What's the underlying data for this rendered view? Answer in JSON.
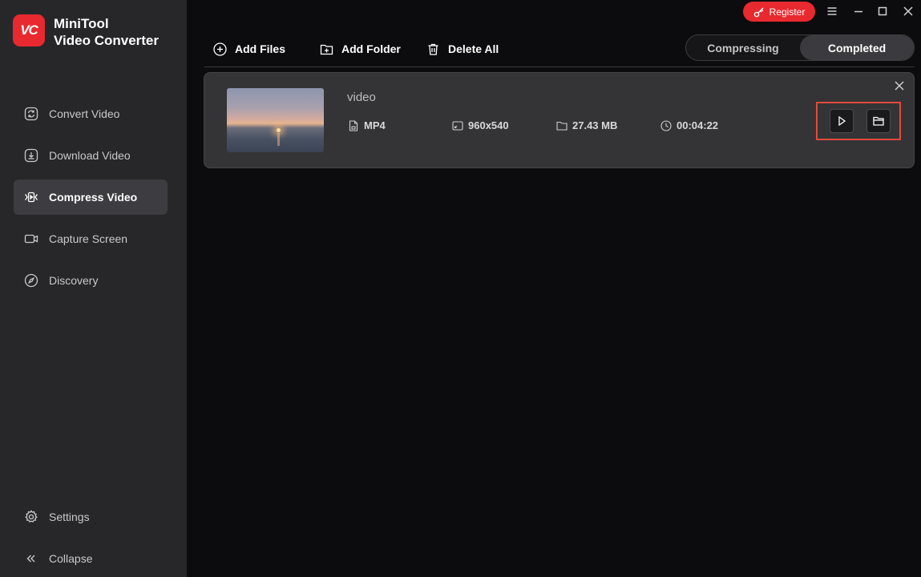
{
  "app": {
    "name_line1": "MiniTool",
    "name_line2": "Video Converter",
    "logo_text": "VC",
    "accent_color": "#e8292f"
  },
  "sidebar": {
    "items": [
      {
        "label": "Convert Video",
        "icon": "convert-icon",
        "active": false
      },
      {
        "label": "Download Video",
        "icon": "download-icon",
        "active": false
      },
      {
        "label": "Compress Video",
        "icon": "compress-icon",
        "active": true
      },
      {
        "label": "Capture Screen",
        "icon": "camera-icon",
        "active": false
      },
      {
        "label": "Discovery",
        "icon": "compass-icon",
        "active": false
      }
    ],
    "bottom": [
      {
        "label": "Settings",
        "icon": "gear-icon"
      },
      {
        "label": "Collapse",
        "icon": "double-chevron-left-icon"
      }
    ]
  },
  "titlebar": {
    "register_label": "Register"
  },
  "toolbar": {
    "add_files": "Add Files",
    "add_folder": "Add Folder",
    "delete_all": "Delete All"
  },
  "tabs": [
    {
      "label": "Compressing",
      "active": false
    },
    {
      "label": "Completed",
      "active": true
    }
  ],
  "file": {
    "name": "video",
    "format": "MP4",
    "resolution": "960x540",
    "size": "27.43 MB",
    "duration": "00:04:22"
  }
}
